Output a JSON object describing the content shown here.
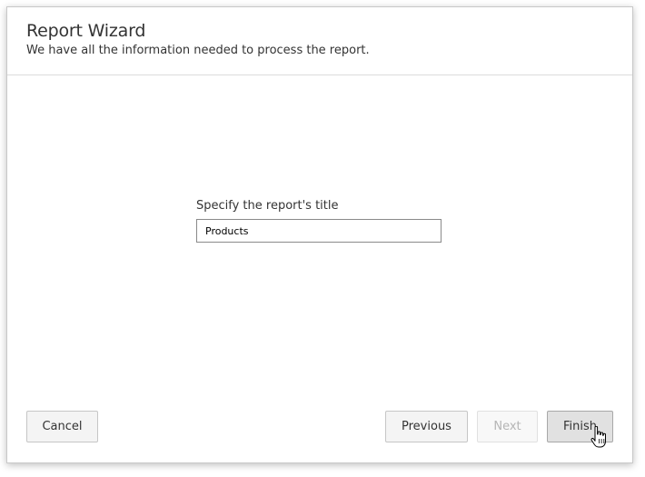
{
  "dialog": {
    "title": "Report Wizard",
    "subtitle": "We have all the information needed to process the report."
  },
  "content": {
    "field_label": "Specify the report's title",
    "title_input_value": "Products"
  },
  "footer": {
    "cancel_label": "Cancel",
    "previous_label": "Previous",
    "next_label": "Next",
    "finish_label": "Finish"
  },
  "icons": {
    "cursor": "hand-pointer-icon"
  }
}
